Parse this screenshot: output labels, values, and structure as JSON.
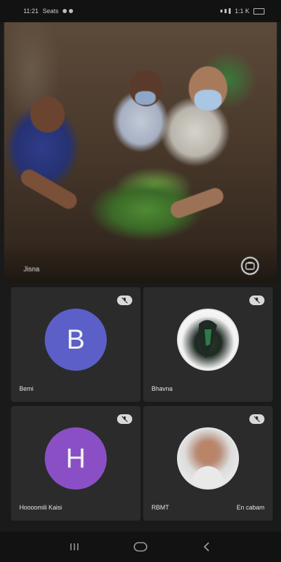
{
  "status_bar": {
    "time": "11:21",
    "carrier": "Seats",
    "battery": "1:1 K"
  },
  "main_feed": {
    "label": "Jisna"
  },
  "participants": [
    {
      "initial": "B",
      "name": "Bemi",
      "avatar_color": "#5b5fc7",
      "type": "letter"
    },
    {
      "initial": "",
      "name": "Bhavna",
      "avatar_color": "",
      "type": "photo"
    },
    {
      "initial": "H",
      "name": "Hoooomili Kaisi",
      "avatar_color": "#8a4fc4",
      "type": "letter"
    },
    {
      "initial": "",
      "name": "RBMT",
      "name_right": "En cabam",
      "avatar_color": "",
      "type": "photo"
    }
  ],
  "nav": {
    "back_icon": "recent-apps-icon",
    "home_icon": "home-icon",
    "recents_icon": "back-icon"
  },
  "colors": {
    "background": "#1a1a1a",
    "tile": "#2b2b2b",
    "avatar_b": "#5b5fc7",
    "avatar_h": "#8a4fc4"
  }
}
